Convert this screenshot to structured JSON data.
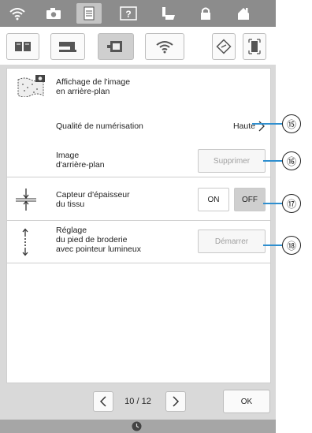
{
  "tabs": {
    "page_indicator": "10 / 12",
    "ok_label": "OK"
  },
  "sections": {
    "background": {
      "title_line1": "Affichage de l'image",
      "title_line2": "en arrière-plan"
    },
    "scan_quality": {
      "label": "Qualité de numérisation",
      "value": "Haute"
    },
    "background_image": {
      "label_line1": "Image",
      "label_line2": "d'arrière-plan",
      "button": "Supprimer"
    },
    "thickness": {
      "label_line1": "Capteur d'épaisseur",
      "label_line2": "du tissu",
      "on": "ON",
      "off": "OFF"
    },
    "foot": {
      "label_line1": "Réglage",
      "label_line2": "du pied de broderie",
      "label_line3": "avec pointeur lumineux",
      "button": "Démarrer"
    }
  },
  "callouts": [
    "⑮",
    "⑯",
    "⑰",
    "⑱"
  ],
  "colors": {
    "callout_line": "#2f8fcf",
    "top_bar": "#8c8c8c"
  }
}
